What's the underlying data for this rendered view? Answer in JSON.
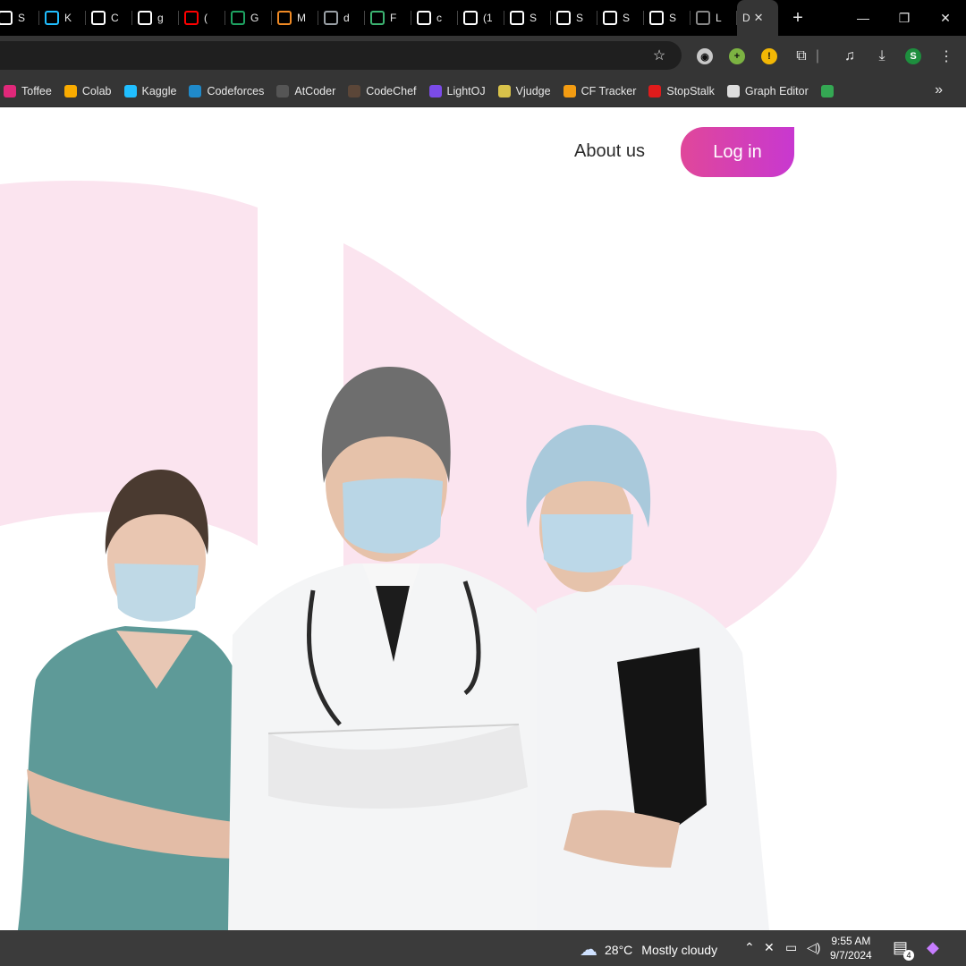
{
  "browser": {
    "tabs": [
      {
        "initial": "S",
        "icon": "chatgpt-icon",
        "color": "#ffffff"
      },
      {
        "initial": "K",
        "icon": "kaggle-icon",
        "color": "#20beff"
      },
      {
        "initial": "C",
        "icon": "chatgpt-icon",
        "color": "#ffffff"
      },
      {
        "initial": "g",
        "icon": "github-icon",
        "color": "#ffffff"
      },
      {
        "initial": "(",
        "icon": "youtube-icon",
        "color": "#ff0000"
      },
      {
        "initial": "G",
        "icon": "sheets-icon",
        "color": "#1ea362"
      },
      {
        "initial": "M",
        "icon": "markdown-icon",
        "color": "#f08a24"
      },
      {
        "initial": "d",
        "icon": "drive-icon",
        "color": "#9aa0a6"
      },
      {
        "initial": "F",
        "icon": "leaf-icon",
        "color": "#3cb371"
      },
      {
        "initial": "c",
        "icon": "chatgpt-icon",
        "color": "#ffffff"
      },
      {
        "initial": "(1",
        "icon": "audio-icon",
        "color": "#ffffff"
      },
      {
        "initial": "S",
        "icon": "github-icon",
        "color": "#ffffff"
      },
      {
        "initial": "S",
        "icon": "github-icon",
        "color": "#ffffff"
      },
      {
        "initial": "S",
        "icon": "github-icon",
        "color": "#ffffff"
      },
      {
        "initial": "S",
        "icon": "github-icon",
        "color": "#ffffff"
      },
      {
        "initial": "L",
        "icon": "github-icon",
        "color": "#888888"
      }
    ],
    "active_tab": {
      "initial": "D",
      "close": "✕"
    },
    "new_tab": "+",
    "window_controls": {
      "minimize": "—",
      "restore": "❐",
      "close": "✕"
    },
    "profile_initial": "S",
    "bookmarks": [
      {
        "label": "Toffee",
        "icon": "toffee-icon",
        "color": "#e0287a"
      },
      {
        "label": "Colab",
        "icon": "colab-icon",
        "color": "#f9ab00"
      },
      {
        "label": "Kaggle",
        "icon": "kaggle-icon",
        "color": "#20beff"
      },
      {
        "label": "Codeforces",
        "icon": "codeforces-icon",
        "color": "#1f8acb"
      },
      {
        "label": "AtCoder",
        "icon": "atcoder-icon",
        "color": "#555555"
      },
      {
        "label": "CodeChef",
        "icon": "codechef-icon",
        "color": "#5b4638"
      },
      {
        "label": "LightOJ",
        "icon": "lightoj-icon",
        "color": "#7b4be8"
      },
      {
        "label": "Vjudge",
        "icon": "vjudge-icon",
        "color": "#d8c24a"
      },
      {
        "label": "CF Tracker",
        "icon": "cftracker-icon",
        "color": "#f39c12"
      },
      {
        "label": "StopStalk",
        "icon": "stopstalk-icon",
        "color": "#e01b1b"
      },
      {
        "label": "Graph Editor",
        "icon": "graph-editor-icon",
        "color": "#dddddd"
      },
      {
        "label": "",
        "icon": "drive-icon",
        "color": "#34a853"
      }
    ]
  },
  "page": {
    "nav": {
      "about": "About us",
      "login": "Log in"
    },
    "accent_gradient": [
      "#e0479a",
      "#c838d0"
    ],
    "blob_color": "#fbe4ef"
  },
  "taskbar": {
    "temperature": "28°C",
    "weather": "Mostly cloudy",
    "time": "9:55 AM",
    "date": "9/7/2024",
    "notifications": "4"
  }
}
